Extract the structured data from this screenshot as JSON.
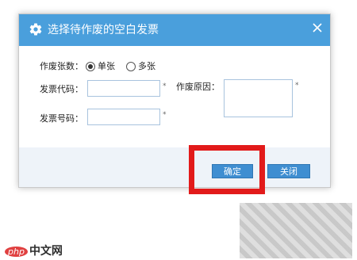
{
  "dialog": {
    "title": "选择待作废的空白发票",
    "title_icon": "gear-icon",
    "close_icon": "close-icon",
    "invalid_count_label": "作废张数：",
    "options": [
      {
        "label": "单张",
        "selected": true
      },
      {
        "label": "多张",
        "selected": false
      }
    ],
    "invoice_code_label": "发票代码：",
    "invoice_code_value": "",
    "invoice_number_label": "发票号码：",
    "invoice_number_value": "",
    "reason_label": "作废原因：",
    "reason_value": "",
    "required_mark": "*",
    "confirm_label": "确定",
    "close_label": "关闭"
  },
  "colors": {
    "titlebar": "#4a9fdc",
    "button": "#3f8ed1",
    "highlight": "#e21a1a",
    "footer_bg": "#eef3f9"
  },
  "watermark": {
    "logo_text": "php",
    "site_text": "中文网"
  }
}
